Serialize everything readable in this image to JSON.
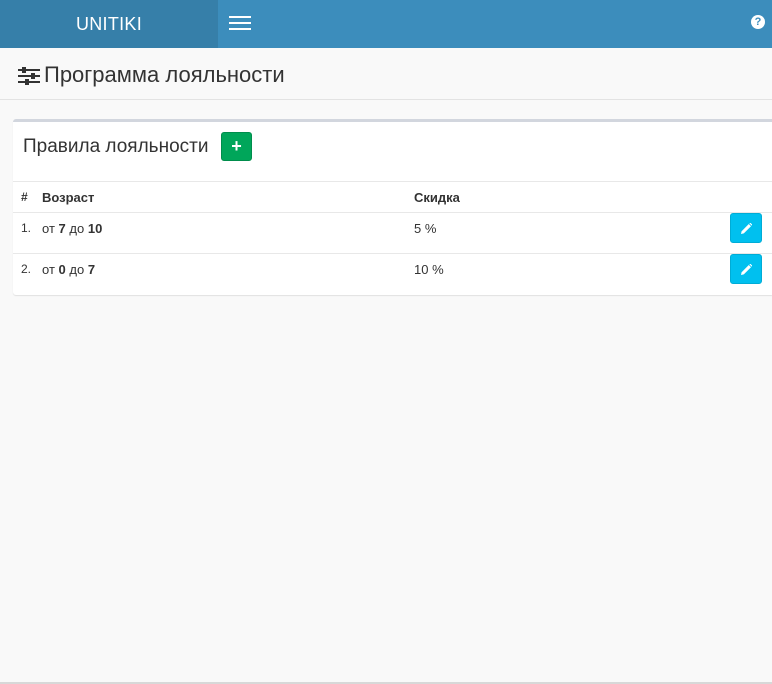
{
  "header": {
    "logo": "UNITIKI",
    "menu_icon": "hamburger-menu-icon",
    "help_icon": "question-circle-icon",
    "help_glyph": "?",
    "color": "#3c8dbc",
    "logo_bg": "#367fa9"
  },
  "page": {
    "title": "Программа лояльности",
    "title_icon": "sliders-icon"
  },
  "box": {
    "title": "Правила лояльности",
    "add_label": "+",
    "add_icon": "plus-icon",
    "add_color": "#00a65a",
    "table": {
      "columns": [
        "#",
        "Возраст",
        "Скидка"
      ],
      "rows": [
        {
          "num": "1.",
          "age_prefix": "от",
          "age_from": "7",
          "age_mid": "до",
          "age_to": "10",
          "discount": "5 %"
        },
        {
          "num": "2.",
          "age_prefix": "от",
          "age_from": "0",
          "age_mid": "до",
          "age_to": "7",
          "discount": "10 %"
        }
      ],
      "edit_icon": "pencil-icon",
      "edit_color": "#00c0ef"
    }
  }
}
